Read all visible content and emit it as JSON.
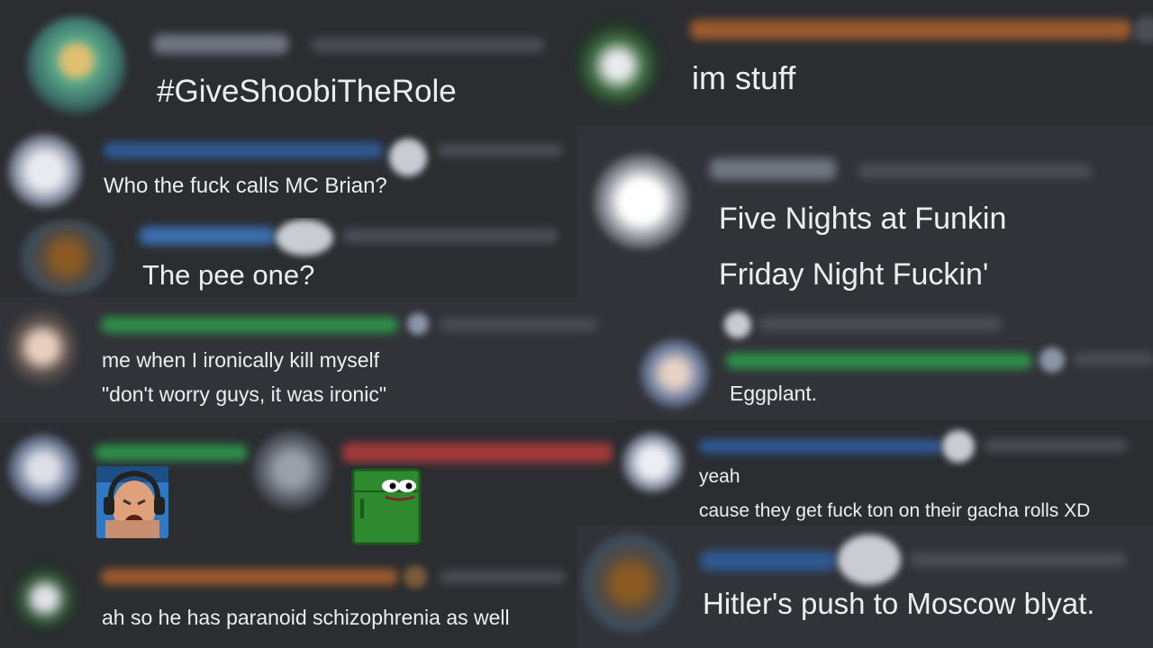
{
  "colors": {
    "bg": "#313338",
    "text": "#eceef0",
    "name_orange": "#9b5a2c",
    "name_blue": "#3b6fb0",
    "name_green": "#2f8f4a",
    "name_red": "#a33a3a",
    "name_gray": "#6f7480"
  },
  "messages": {
    "m1": "#GiveShoobiTheRole",
    "m2": "Who the fuck calls MC Brian?",
    "m3": "The pee one?",
    "m4a": "me when I ironically kill myself",
    "m4b": "\"don't worry guys, it was ironic\"",
    "m5": "ah so he has paranoid schizophrenia as well",
    "r1": "im stuff",
    "r2a": "Five Nights at Funkin",
    "r2b": "Friday Night Fuckin'",
    "r3": "Eggplant.",
    "r4a": "yeah",
    "r4b": "cause they get fuck ton on their gacha rolls XD",
    "r5": "Hitler's push to Moscow blyat."
  },
  "emotes": {
    "e1": "screaming-man-headset-emote",
    "e2": "pepe-fridge-emote"
  }
}
